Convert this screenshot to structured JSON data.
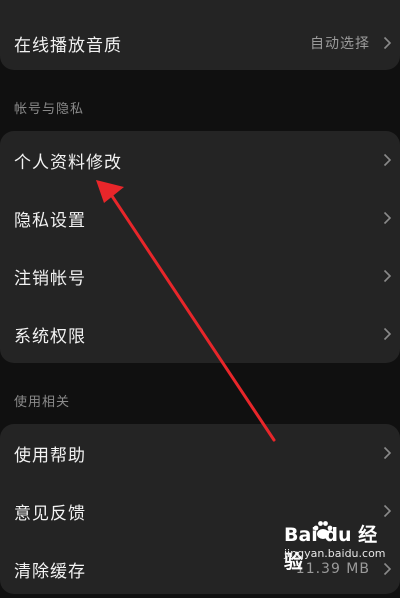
{
  "top_card": {
    "audio_quality": {
      "label": "在线播放音质",
      "value": "自动选择"
    }
  },
  "section_account": {
    "header": "帐号与隐私",
    "items": [
      {
        "label": "个人资料修改"
      },
      {
        "label": "隐私设置"
      },
      {
        "label": "注销帐号"
      },
      {
        "label": "系统权限"
      }
    ]
  },
  "section_usage": {
    "header": "使用相关",
    "items": [
      {
        "label": "使用帮助"
      },
      {
        "label": "意见反馈"
      },
      {
        "label": "清除缓存",
        "value": "11.39 MB"
      }
    ]
  },
  "watermark": {
    "logo": "Bai du 经验",
    "url": "jingyan.baidu.com"
  },
  "colors": {
    "background": "#101010",
    "card": "#242424",
    "arrow": "#e8262a"
  },
  "icons": {
    "row_chevron": "chevron-right-icon",
    "watermark_paw": "paw-icon"
  }
}
